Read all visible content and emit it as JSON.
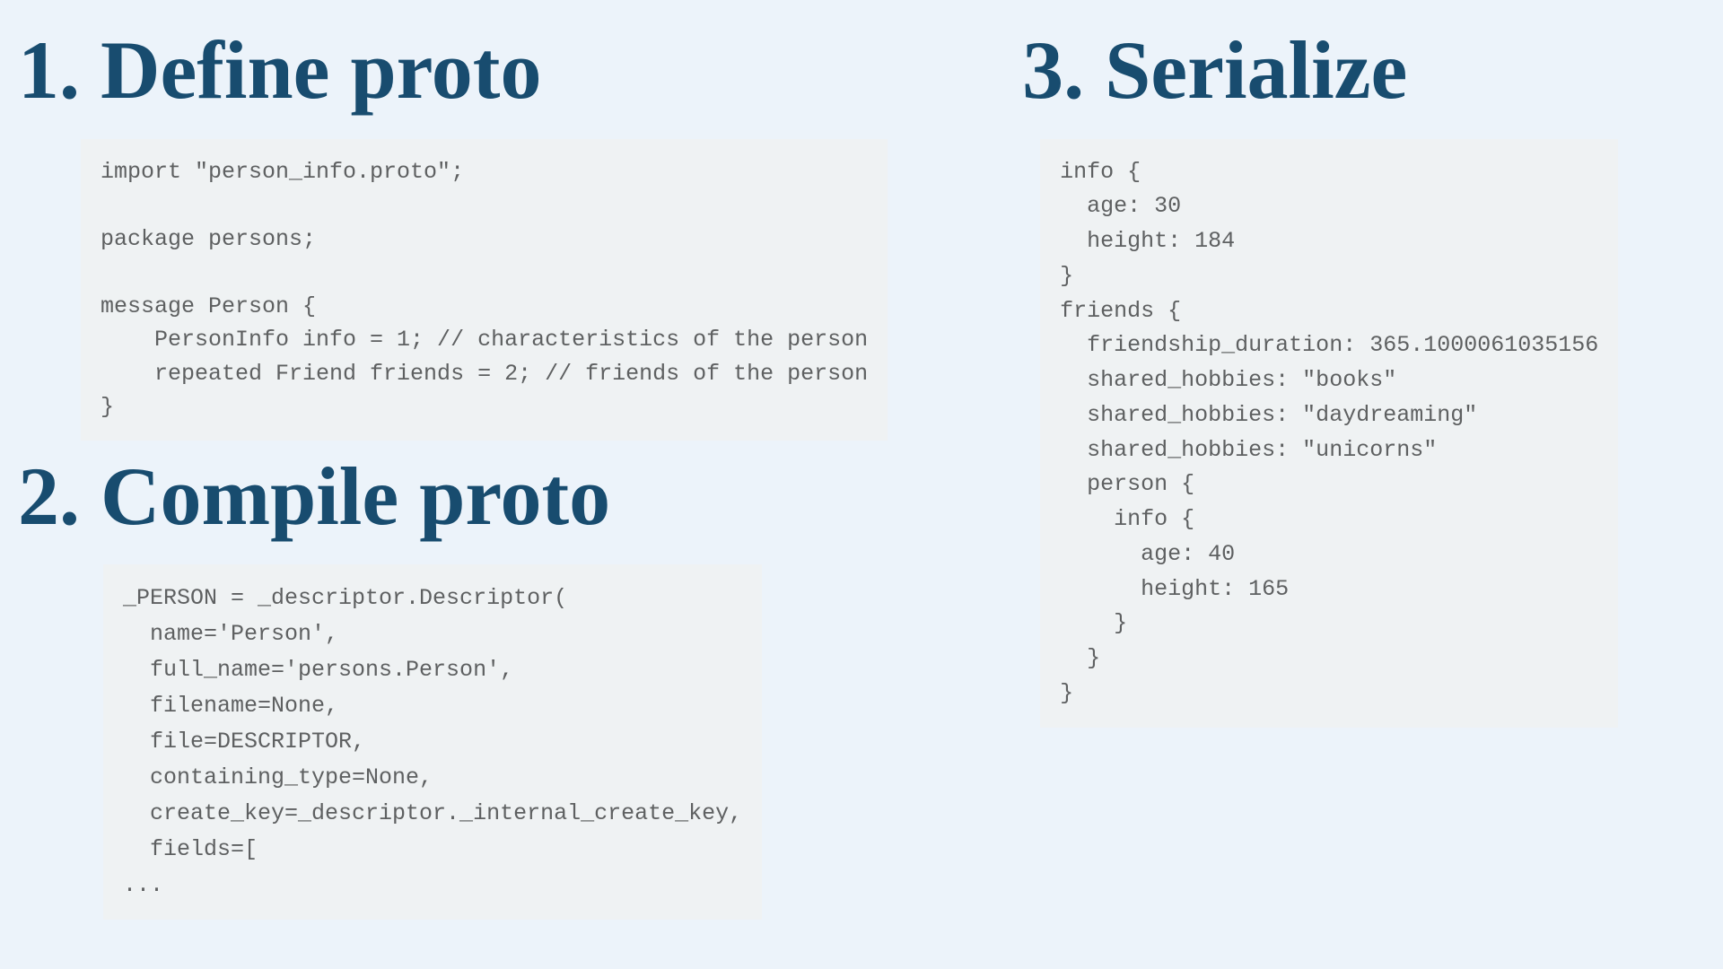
{
  "left": {
    "section1": {
      "heading": "1. Define proto",
      "code": "import \"person_info.proto\";\n\npackage persons;\n\nmessage Person {\n    PersonInfo info = 1; // characteristics of the person\n    repeated Friend friends = 2; // friends of the person\n}"
    },
    "section2": {
      "heading": "2. Compile proto",
      "code": "_PERSON = _descriptor.Descriptor(\n  name='Person',\n  full_name='persons.Person',\n  filename=None,\n  file=DESCRIPTOR,\n  containing_type=None,\n  create_key=_descriptor._internal_create_key,\n  fields=[\n..."
    }
  },
  "right": {
    "section3": {
      "heading": "3. Serialize",
      "code": "info {\n  age: 30\n  height: 184\n}\nfriends {\n  friendship_duration: 365.1000061035156\n  shared_hobbies: \"books\"\n  shared_hobbies: \"daydreaming\"\n  shared_hobbies: \"unicorns\"\n  person {\n    info {\n      age: 40\n      height: 165\n    }\n  }\n}"
    }
  }
}
